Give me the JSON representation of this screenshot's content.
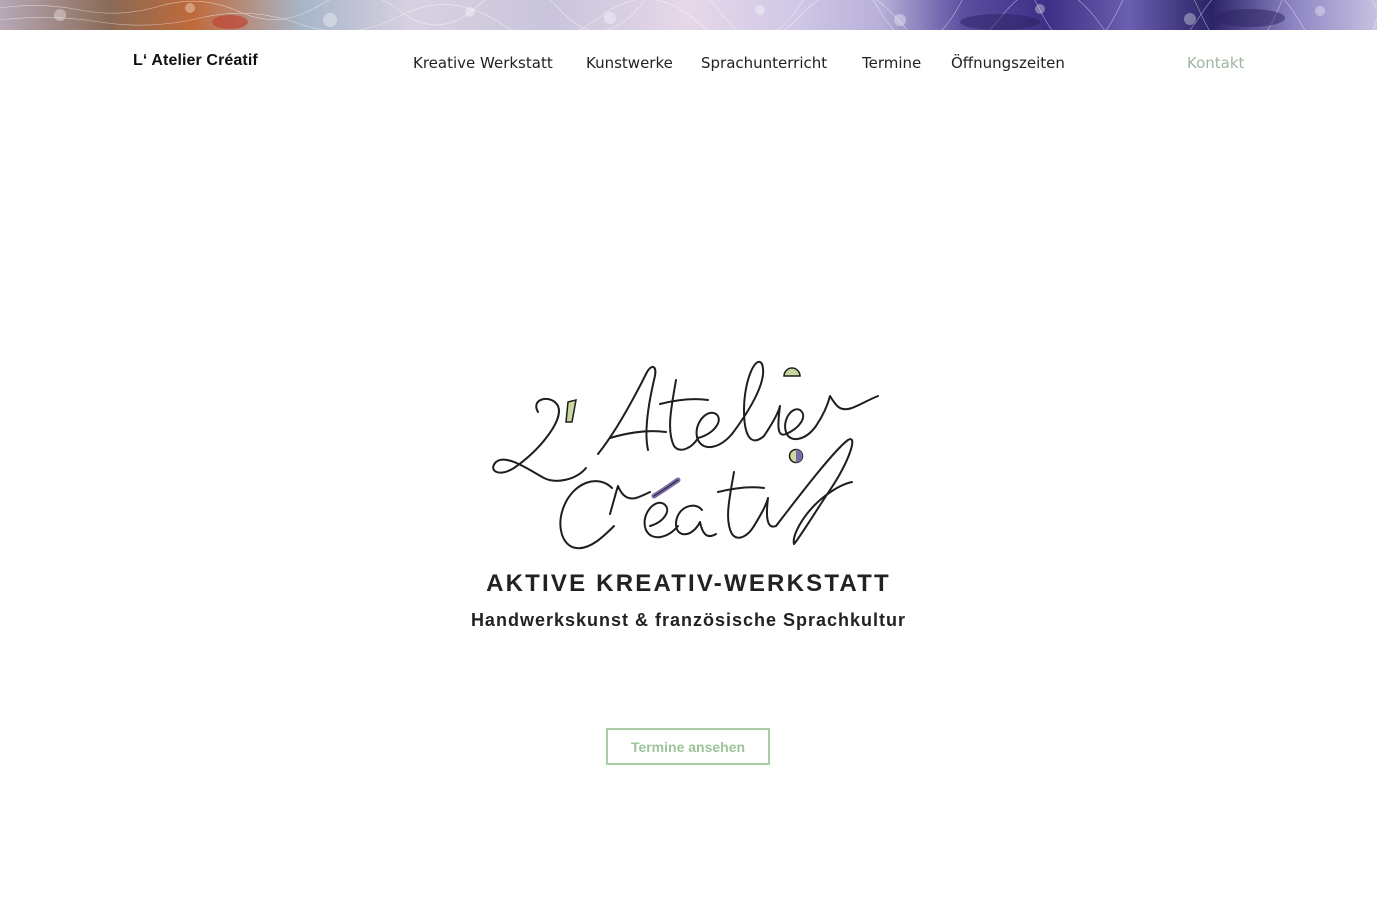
{
  "header_image": {
    "icon": "stained-glass-mosaic-banner"
  },
  "brand": {
    "label": "L‘ Atelier Créatif"
  },
  "nav": {
    "items": [
      {
        "label": "Kreative Werkstatt"
      },
      {
        "label": "Kunstwerke"
      },
      {
        "label": "Sprachunterricht"
      },
      {
        "label": "Termine"
      },
      {
        "label": "Öffnungszeiten"
      }
    ],
    "contact_label": "Kontakt"
  },
  "hero": {
    "logo_text_line1": "L'Atelier",
    "logo_text_line2": "Créatif",
    "title": "AKTIVE KREATIV-WERKSTATT",
    "subtitle": "Handwerkskunst & französische Sprachkultur",
    "cta_label": "Termine ansehen"
  },
  "colors": {
    "accent": "#a8cda7",
    "contact": "#9fb5a1",
    "text": "#222222",
    "logo_purple": "#7a6aa8",
    "logo_green": "#c9d8a0"
  }
}
